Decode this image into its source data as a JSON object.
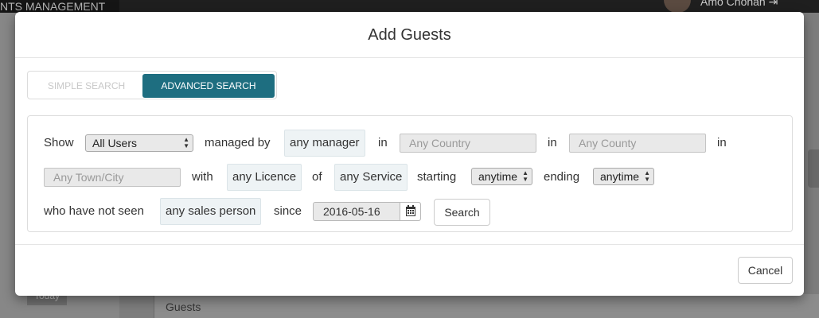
{
  "background": {
    "brand": "NTS MANAGEMENT",
    "user": "Amo Chohan",
    "today": "Today",
    "guests_label": "Guests"
  },
  "modal": {
    "title": "Add Guests",
    "tabs": {
      "simple": "SIMPLE SEARCH",
      "advanced": "ADVANCED SEARCH",
      "active": "advanced"
    },
    "filters": {
      "show_label": "Show",
      "show_value": "All Users",
      "managed_by_label": "managed by",
      "manager_value": "any manager",
      "in_label_1": "in",
      "country_placeholder": "Any Country",
      "in_label_2": "in",
      "county_placeholder": "Any County",
      "in_label_3": "in",
      "town_placeholder": "Any Town/City",
      "with_label": "with",
      "licence_value": "any Licence",
      "of_label": "of",
      "service_value": "any Service",
      "starting_label": "starting",
      "starting_value": "anytime",
      "ending_label": "ending",
      "ending_value": "anytime",
      "not_seen_label": "who have not seen",
      "sales_person_value": "any sales person",
      "since_label": "since",
      "since_date": "2016-05-16",
      "search_button": "Search"
    },
    "cancel_button": "Cancel"
  },
  "colors": {
    "accent": "#1e6e80",
    "chip_bg": "#eef3f5",
    "overlay": "#7d7d7d"
  }
}
